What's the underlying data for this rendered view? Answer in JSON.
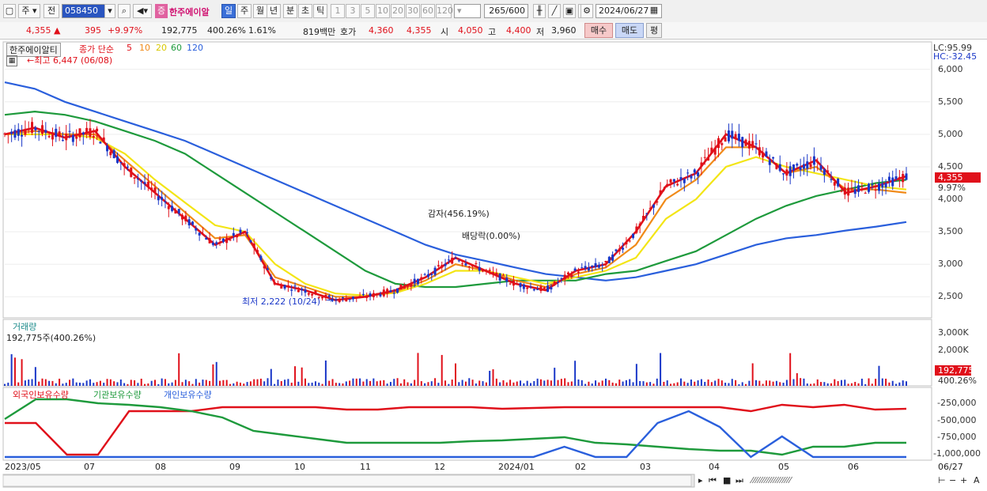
{
  "toolbar": {
    "type_label": "주",
    "prefix_label": "전",
    "code_value": "058450",
    "stock_name": "한주에이알",
    "badge_label": "증",
    "period_tabs": [
      "일",
      "주",
      "월",
      "년",
      "분",
      "초",
      "틱"
    ],
    "interval_tabs": [
      "1",
      "3",
      "5",
      "10",
      "20",
      "30",
      "60",
      "120"
    ],
    "count_value": "265",
    "count_total": "/600",
    "date_value": "2024/06/27"
  },
  "quote": {
    "price": "4,355",
    "change": "395",
    "change_pct": "+9.97%",
    "volume": "192,775",
    "volume_pct": "400.26%",
    "turnover": "1.61%",
    "amount": "819백만",
    "ask_label": "호가",
    "ask1": "4,360",
    "ask2": "4,355",
    "open_label": "시",
    "open": "4,050",
    "high_label": "고",
    "high": "4,400",
    "low_label": "저",
    "low": "3,960",
    "buy_label": "매수",
    "sell_label": "매도",
    "pyeong_label": "평"
  },
  "price_pane": {
    "legend_name": "한주에이알티",
    "legend_ma": "종가 단순",
    "ma_periods": [
      "5",
      "10",
      "20",
      "60",
      "120"
    ],
    "ma_colors": [
      "#e0101a",
      "#f08a18",
      "#f3e515",
      "#1e9a3c",
      "#2a5fdc"
    ],
    "high_marker": "←최고 6,447 (06/08)",
    "low_marker": "최저 2,222 (10/24)",
    "annot1": "감자(456.19%)",
    "annot2": "배당락(0.00%)",
    "lc_label": "LC:95.99",
    "hc_label": "HC:-32.45",
    "yticks": [
      "6,000",
      "5,500",
      "5,000",
      "4,500",
      "4,000",
      "3,500",
      "3,000",
      "2,500"
    ],
    "price_tag": "4,355",
    "pct_tag": "9.97%"
  },
  "volume_pane": {
    "title": "거래량",
    "value_text": "192,775주(400.26%)",
    "yticks": [
      "3,000K",
      "2,000K",
      "1,000K"
    ],
    "value_tag": "192,775",
    "pct_tag": "400.26%"
  },
  "holding_pane": {
    "legend": [
      "외국인보유수량",
      "기관보유수량",
      "개인보유수량"
    ],
    "legend_colors": [
      "#e0101a",
      "#1e9a3c",
      "#2a5fdc"
    ],
    "yticks": [
      "-250,000",
      "-500,000",
      "-750,000",
      "-1,000,000"
    ]
  },
  "xaxis": {
    "labels": [
      "2023/05",
      "07",
      "08",
      "09",
      "10",
      "11",
      "12",
      "2024/01",
      "02",
      "03",
      "04",
      "05",
      "06",
      "06/27"
    ]
  },
  "chart_data": {
    "type": "line",
    "title": "",
    "series": [
      {
        "name": "5",
        "values": [
          5000,
          5100,
          4950,
          5050,
          4500,
          4100,
          3700,
          3300,
          3500,
          2700,
          2600,
          2450,
          2500,
          2600,
          2800,
          3100,
          2900,
          2700,
          2600,
          2900,
          3000,
          3500,
          4200,
          4400,
          5000,
          4800,
          4400,
          4600,
          4100,
          4200,
          4355
        ]
      },
      {
        "name": "10",
        "values": [
          5000,
          5050,
          5000,
          5000,
          4600,
          4200,
          3800,
          3400,
          3450,
          2800,
          2650,
          2500,
          2500,
          2580,
          2750,
          3000,
          2900,
          2750,
          2650,
          2850,
          2950,
          3300,
          4000,
          4300,
          4800,
          4800,
          4400,
          4500,
          4150,
          4150,
          4100
        ]
      },
      {
        "name": "20",
        "values": [
          5000,
          5000,
          5000,
          4950,
          4700,
          4300,
          3950,
          3600,
          3500,
          3000,
          2700,
          2550,
          2520,
          2560,
          2700,
          2900,
          2900,
          2800,
          2700,
          2800,
          2900,
          3100,
          3700,
          4000,
          4500,
          4650,
          4500,
          4400,
          4300,
          4200,
          4150
        ]
      },
      {
        "name": "60",
        "values": [
          5300,
          5350,
          5300,
          5200,
          5050,
          4900,
          4700,
          4400,
          4100,
          3800,
          3500,
          3200,
          2900,
          2700,
          2650,
          2650,
          2700,
          2750,
          2750,
          2750,
          2850,
          2900,
          3050,
          3200,
          3450,
          3700,
          3900,
          4050,
          4150,
          4250,
          4300
        ]
      },
      {
        "name": "120",
        "values": [
          5800,
          5700,
          5500,
          5350,
          5200,
          5050,
          4900,
          4700,
          4500,
          4300,
          4100,
          3900,
          3700,
          3500,
          3300,
          3150,
          3050,
          2950,
          2850,
          2800,
          2750,
          2800,
          2900,
          3000,
          3150,
          3300,
          3400,
          3450,
          3520,
          3580,
          3650
        ]
      }
    ],
    "ylim": [
      2200,
      6300
    ]
  }
}
